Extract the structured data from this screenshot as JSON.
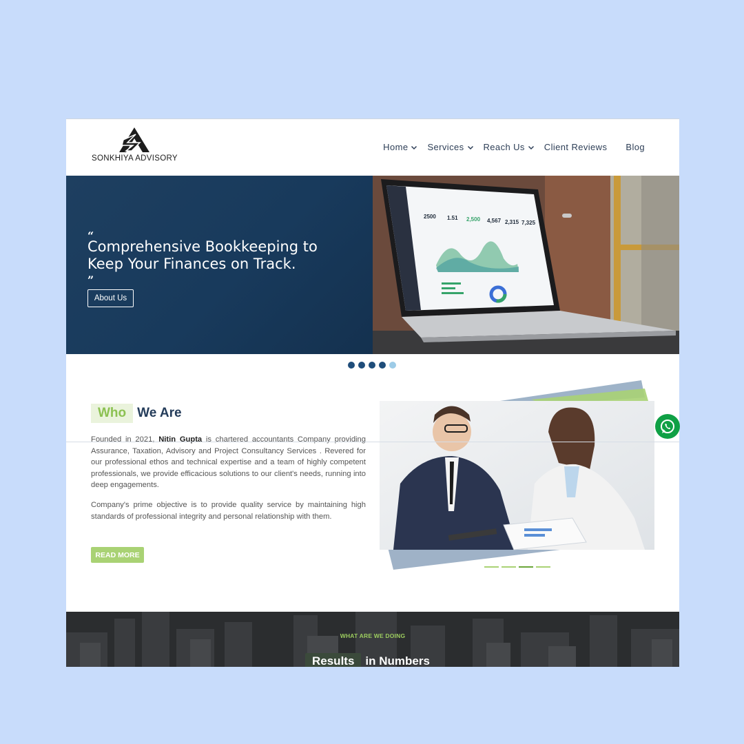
{
  "brand": {
    "name": "SONKHIYA ADVISORY"
  },
  "nav": {
    "items": [
      {
        "label": "Home",
        "has_dropdown": true
      },
      {
        "label": "Services",
        "has_dropdown": true
      },
      {
        "label": "Reach Us",
        "has_dropdown": true
      },
      {
        "label": "Client Reviews",
        "has_dropdown": false
      },
      {
        "label": "Blog",
        "has_dropdown": false
      }
    ]
  },
  "hero": {
    "open_quote": "“",
    "title": "Comprehensive Bookkeeping to Keep Your Finances on Track.",
    "close_quote": "”",
    "button_label": "About Us",
    "slide_count": 5,
    "active_slide": 5,
    "dashboard_stats": [
      "2500",
      "1.51",
      "2,500",
      "4,567",
      "2,315",
      "7,325"
    ]
  },
  "who": {
    "highlight": "Who",
    "rest": "We Are",
    "para1_a": "Founded in 2021, ",
    "para1_name": "Nitin Gupta",
    "para1_b": " is chartered accountants Company providing Assurance, Taxation, Advisory and Project Consultancy Services . Revered for our professional ethos and technical expertise and a team of highly competent professionals, we provide efficacious solutions to our client's needs, running into deep engagements.",
    "para2": "Company's prime objective is to provide quality service by maintaining high standards of professional integrity and personal relationship with them.",
    "button_label": "READ MORE",
    "carousel_count": 4,
    "carousel_active": 3
  },
  "results": {
    "subtitle": "WHAT ARE WE DOING",
    "title_highlight": "Results",
    "title_rest": "in Numbers"
  },
  "colors": {
    "page_bg": "#c8dcfb",
    "hero_navy": "#1b3c5e",
    "accent_green": "#a9d274",
    "heading_navy": "#243c5a",
    "whatsapp_green": "#0fa045"
  }
}
